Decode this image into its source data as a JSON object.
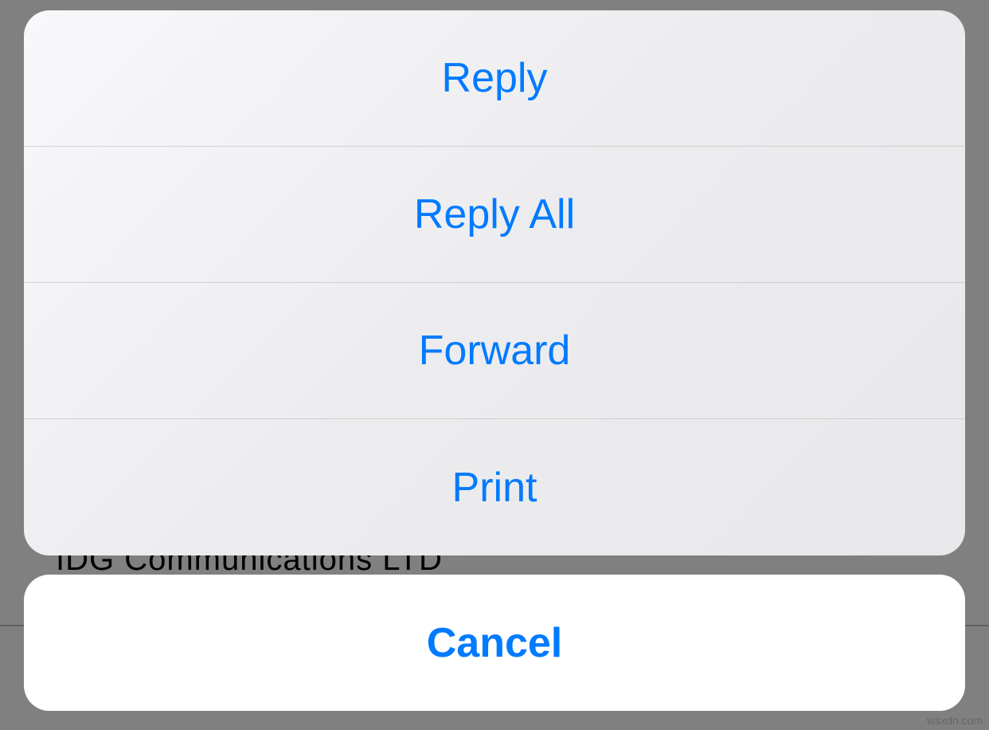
{
  "actionSheet": {
    "options": [
      {
        "label": "Reply"
      },
      {
        "label": "Reply All"
      },
      {
        "label": "Forward"
      },
      {
        "label": "Print"
      }
    ],
    "cancel": "Cancel"
  },
  "background": {
    "visibleText": "IDG Communications LTD"
  },
  "watermark": "wsxdn.com"
}
